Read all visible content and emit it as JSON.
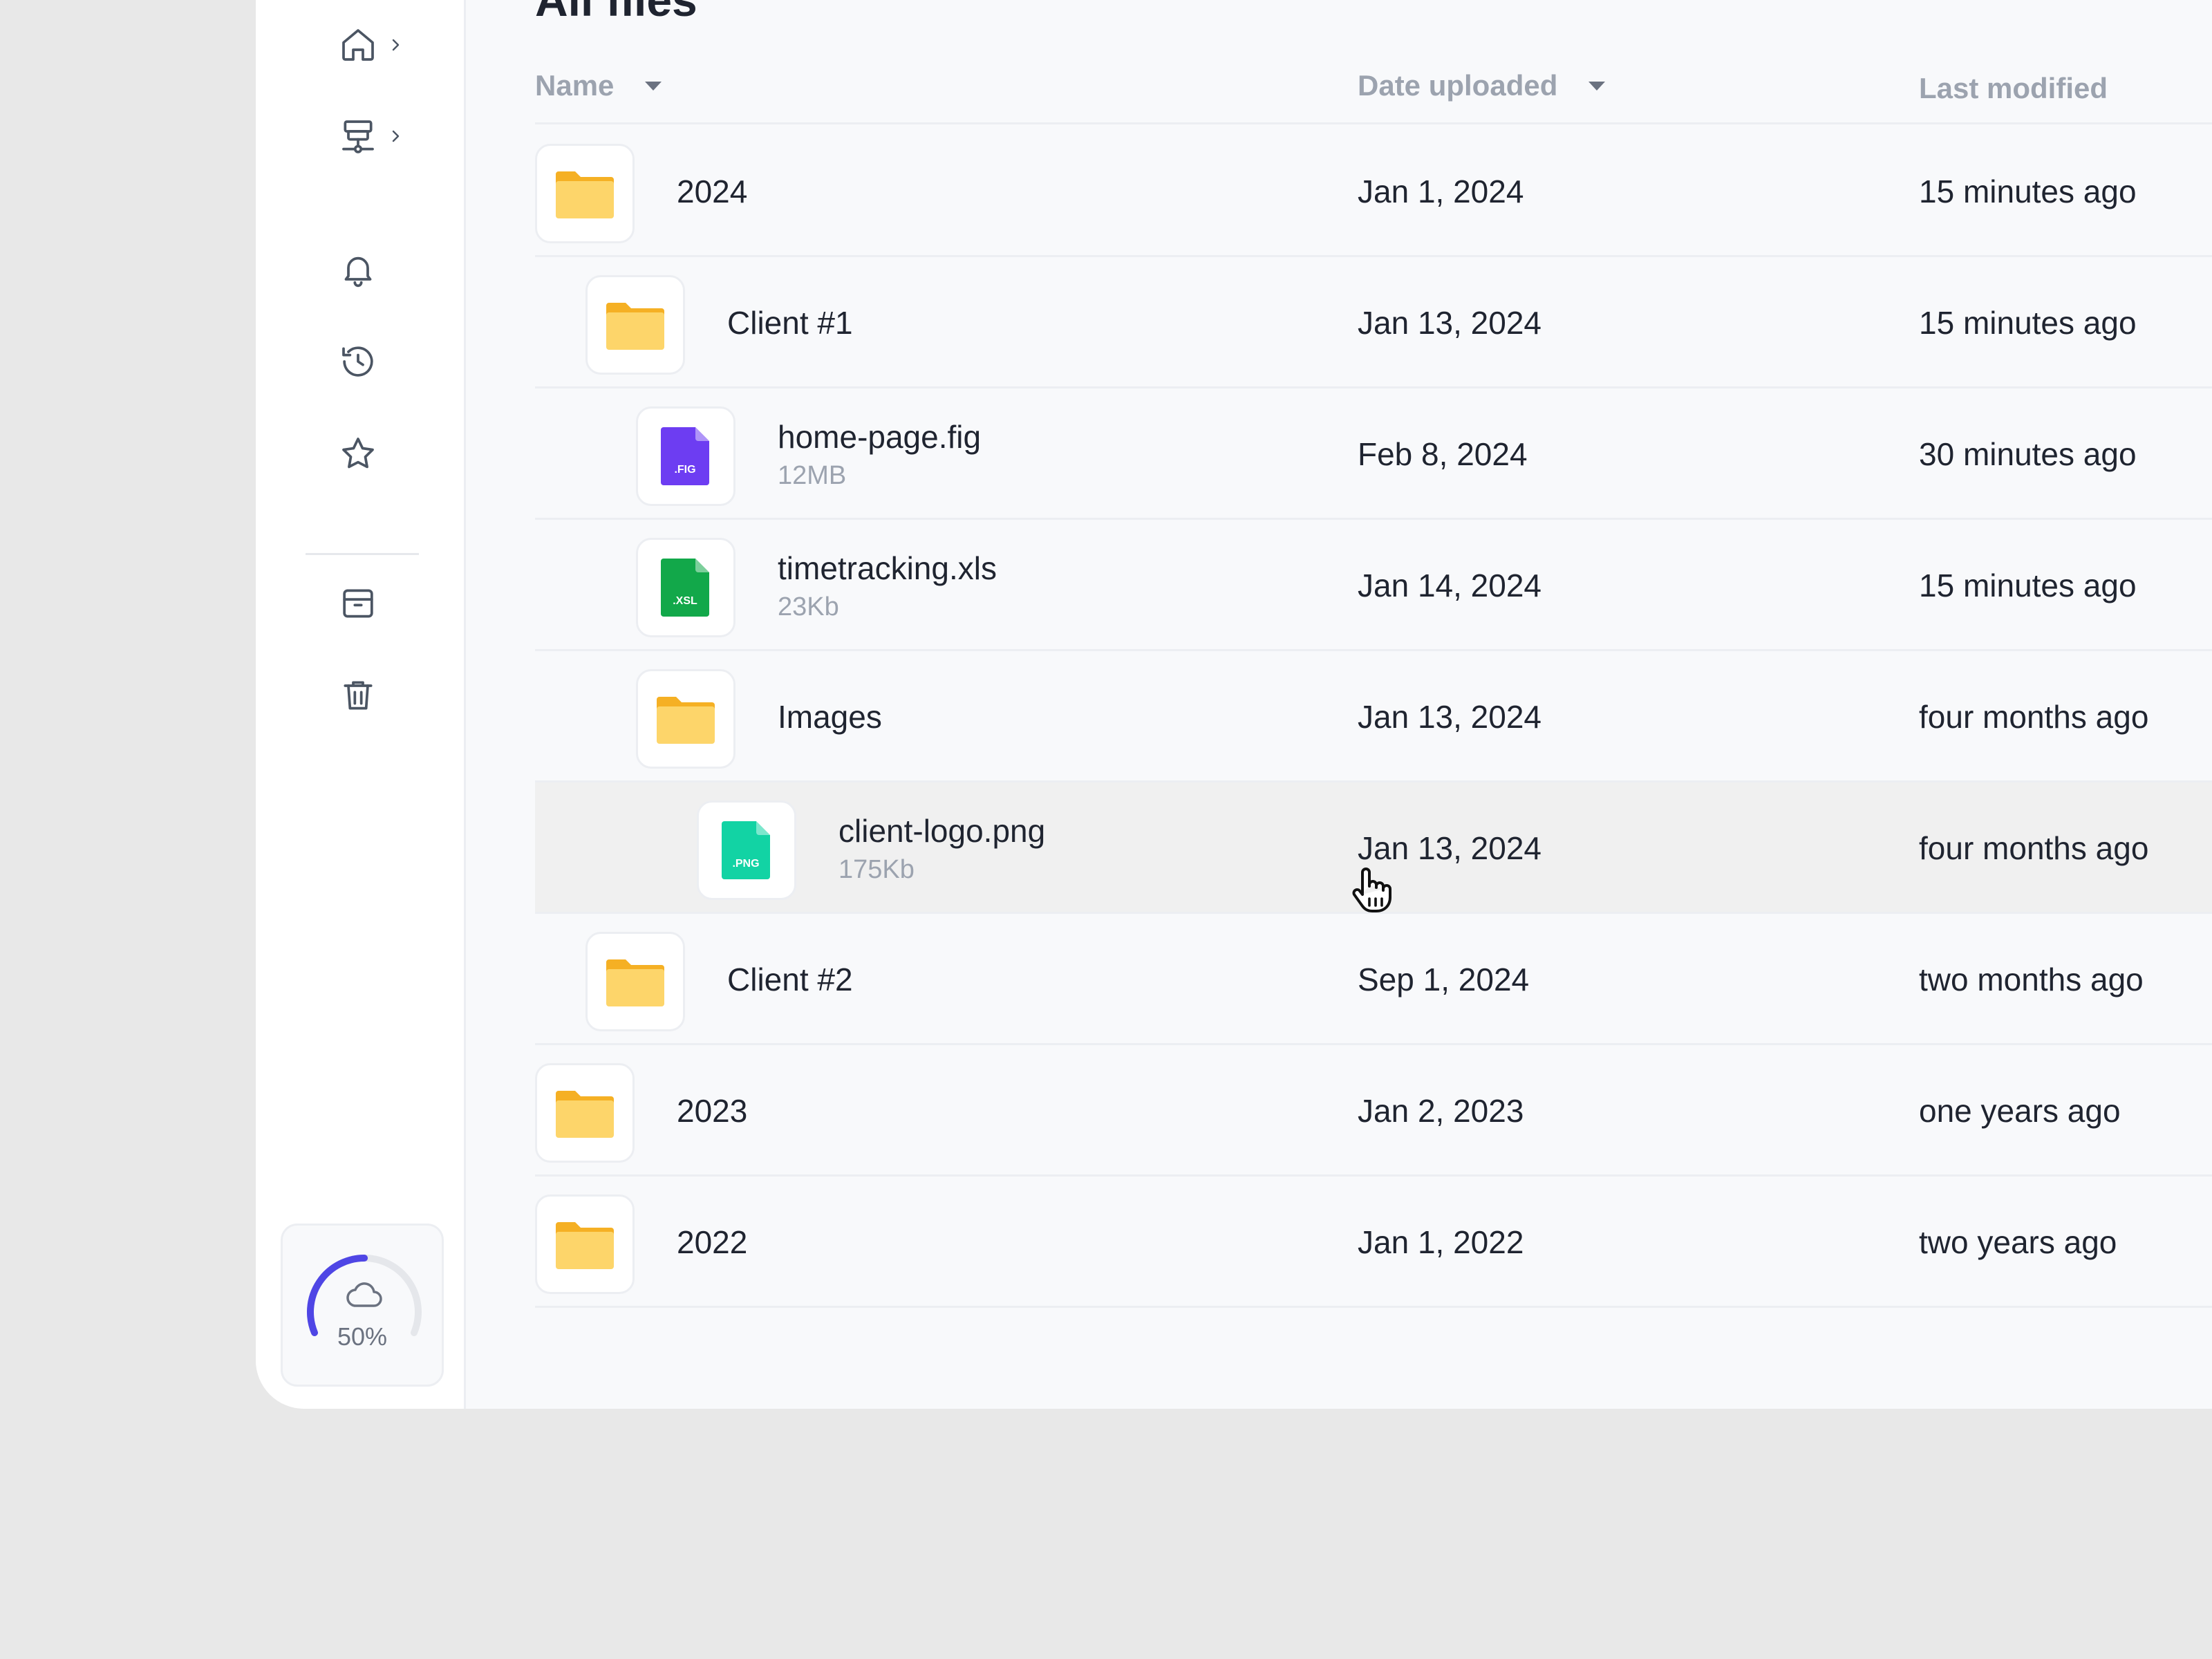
{
  "page": {
    "title": "All files"
  },
  "sidebar": {
    "items": [
      {
        "icon": "home-icon",
        "has_chevron": true
      },
      {
        "icon": "network-icon",
        "has_chevron": true
      },
      {
        "icon": "bell-icon"
      },
      {
        "icon": "history-icon"
      },
      {
        "icon": "star-icon"
      },
      {
        "icon": "archive-icon"
      },
      {
        "icon": "trash-icon"
      }
    ],
    "storage": {
      "percent_label": "50%",
      "used_fraction": 0.5,
      "icon": "cloud-icon",
      "accent": "#4f46e5"
    }
  },
  "table": {
    "columns": {
      "name": "Name",
      "date_uploaded": "Date uploaded",
      "last_modified": "Last modified"
    },
    "rows": [
      {
        "type": "folder",
        "name": "2024",
        "size": "",
        "date": "Jan 1, 2024",
        "modified": "15 minutes ago",
        "depth": 0
      },
      {
        "type": "folder",
        "name": "Client #1",
        "size": "",
        "date": "Jan 13, 2024",
        "modified": "15 minutes ago",
        "depth": 1
      },
      {
        "type": "fig",
        "badge": ".FIG",
        "name": "home-page.fig",
        "size": "12MB",
        "date": "Feb 8, 2024",
        "modified": "30 minutes ago",
        "depth": 2
      },
      {
        "type": "xsl",
        "badge": ".XSL",
        "name": "timetracking.xls",
        "size": "23Kb",
        "date": "Jan 14, 2024",
        "modified": "15 minutes ago",
        "depth": 2
      },
      {
        "type": "folder",
        "name": "Images",
        "size": "",
        "date": "Jan 13, 2024",
        "modified": "four months ago",
        "depth": 2
      },
      {
        "type": "png",
        "badge": ".PNG",
        "name": "client-logo.png",
        "size": "175Kb",
        "date": "Jan 13, 2024",
        "modified": "four months ago",
        "depth": 3,
        "hover": true
      },
      {
        "type": "folder",
        "name": "Client #2",
        "size": "",
        "date": "Sep 1, 2024",
        "modified": "two months ago",
        "depth": 1
      },
      {
        "type": "folder",
        "name": "2023",
        "size": "",
        "date": "Jan 2, 2023",
        "modified": "one years ago",
        "depth": 0
      },
      {
        "type": "folder",
        "name": "2022",
        "size": "",
        "date": "Jan 1, 2022",
        "modified": "two years ago",
        "depth": 0
      }
    ]
  },
  "colors": {
    "folder_back": "#f5b024",
    "folder_front": "#fdd56a",
    "fig": "#6d3df2",
    "xsl": "#12a84a",
    "png": "#12d3a4"
  }
}
